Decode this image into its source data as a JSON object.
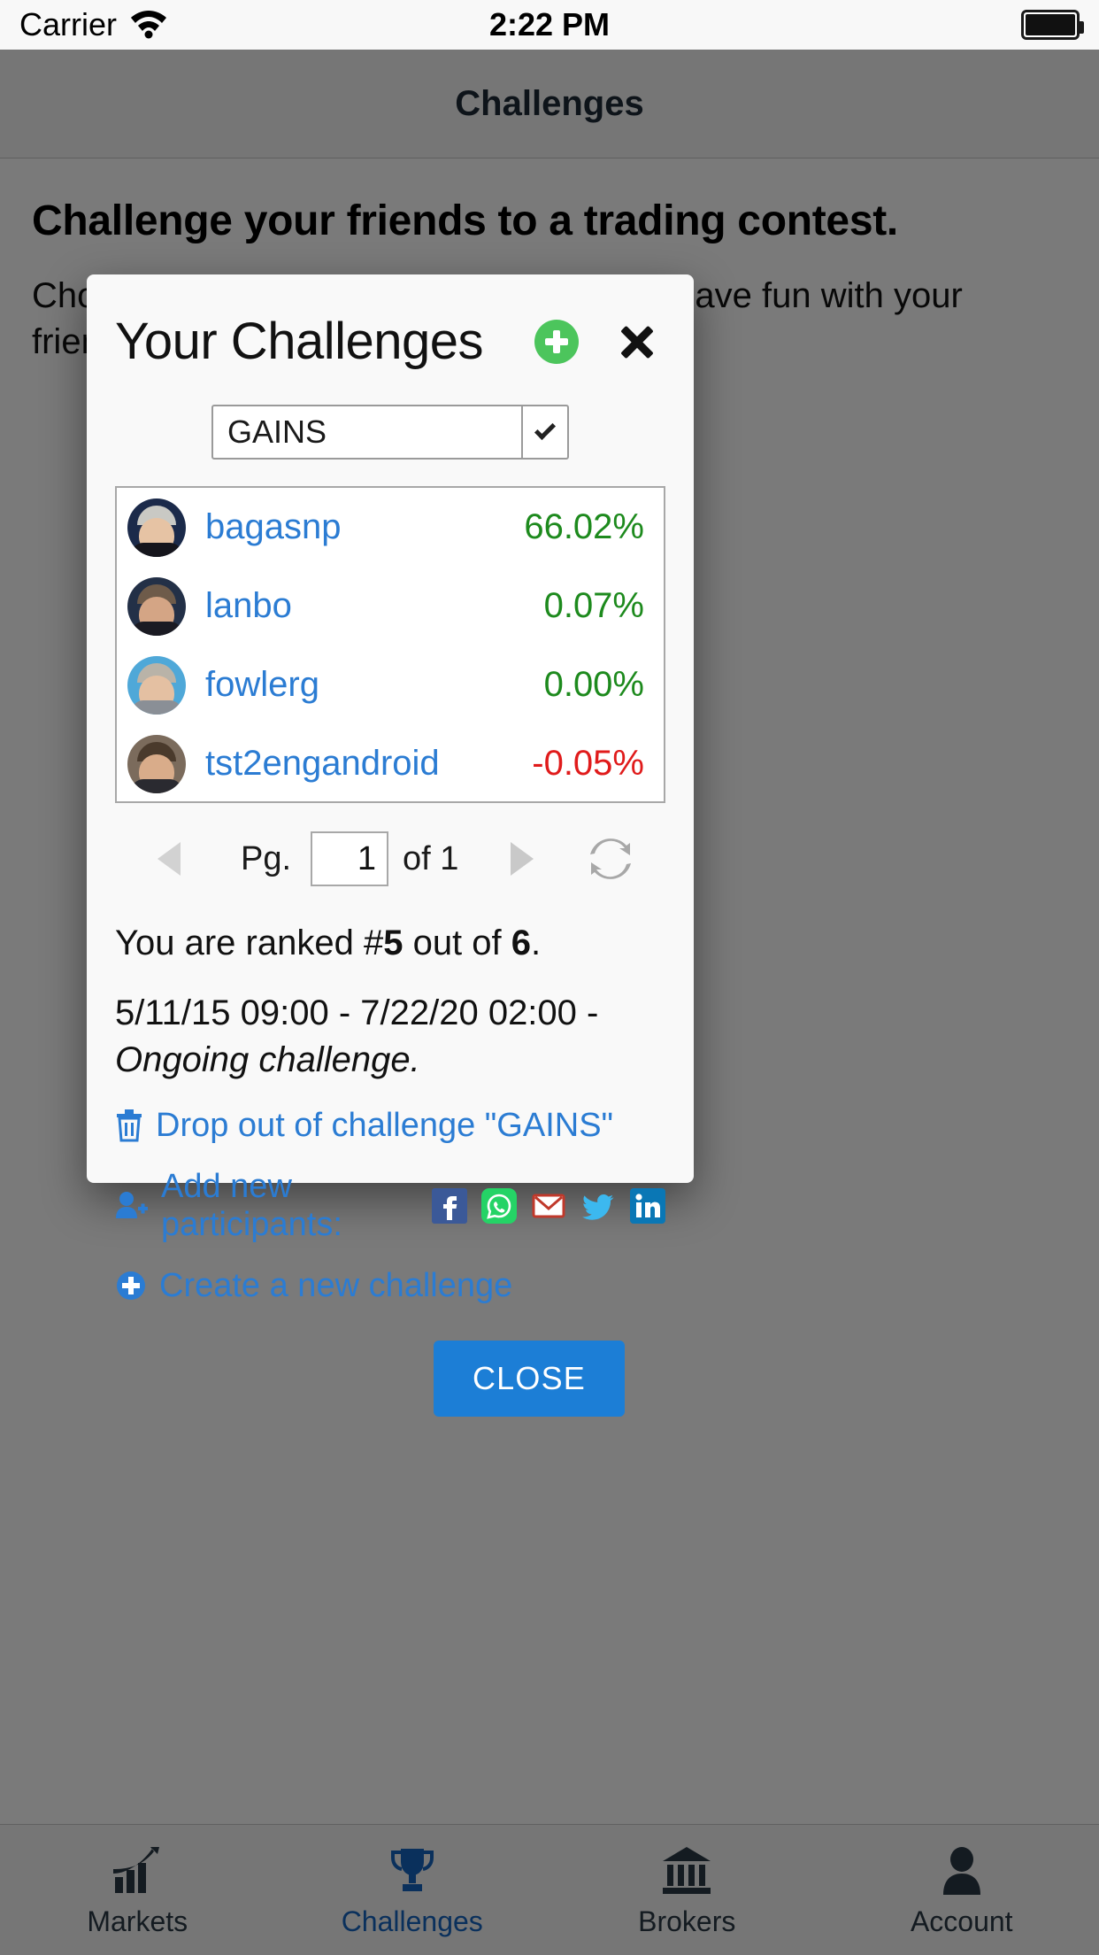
{
  "status_bar": {
    "carrier": "Carrier",
    "wifi_icon": "wifi-icon",
    "time": "2:22 PM",
    "battery_icon": "battery-full-icon"
  },
  "navbar": {
    "title": "Challenges"
  },
  "page": {
    "heading": "Challenge your friends to a trading contest.",
    "subheading": "Choose the dates of the tournament and have fun with your friends."
  },
  "modal": {
    "title": "Your Challenges",
    "add_icon": "plus-circle-icon",
    "close_icon": "close-icon",
    "select": {
      "value": "GAINS",
      "arrow_icon": "chevron-down-icon"
    },
    "leaderboard": [
      {
        "avatar": "avatar",
        "username": "bagasnp",
        "percent": "66.02%",
        "sign": "pos"
      },
      {
        "avatar": "avatar",
        "username": "lanbo",
        "percent": "0.07%",
        "sign": "pos"
      },
      {
        "avatar": "avatar",
        "username": "fowlerg",
        "percent": "0.00%",
        "sign": "pos"
      },
      {
        "avatar": "avatar",
        "username": "tst2engandroid",
        "percent": "-0.05%",
        "sign": "neg"
      }
    ],
    "pager": {
      "prev_icon": "triangle-left-icon",
      "label": "Pg.",
      "page_value": "1",
      "of_text": "of 1",
      "next_icon": "triangle-right-icon",
      "refresh_icon": "refresh-icon"
    },
    "rank": {
      "prefix": "You are ranked #",
      "rank_number": "5",
      "middle": " out of ",
      "total": "6",
      "suffix": "."
    },
    "dates": {
      "range": "5/11/15 09:00 - 7/22/20 02:00 - ",
      "status": "Ongoing challenge."
    },
    "drop_out": {
      "icon": "trash-icon",
      "label": "Drop out of challenge \"GAINS\""
    },
    "add_participants": {
      "icon": "user-plus-icon",
      "label": "Add new participants:",
      "socials": [
        {
          "name": "facebook-icon"
        },
        {
          "name": "whatsapp-icon"
        },
        {
          "name": "email-icon"
        },
        {
          "name": "twitter-icon"
        },
        {
          "name": "linkedin-icon"
        }
      ]
    },
    "create_challenge": {
      "icon": "plus-circle-icon",
      "label": "Create a new challenge"
    },
    "close_button": "CLOSE"
  },
  "tabbar": [
    {
      "icon": "chart-growth-icon",
      "label": "Markets",
      "active": false
    },
    {
      "icon": "trophy-icon",
      "label": "Challenges",
      "active": true
    },
    {
      "icon": "bank-icon",
      "label": "Brokers",
      "active": false
    },
    {
      "icon": "person-icon",
      "label": "Account",
      "active": false
    }
  ],
  "colors": {
    "link_blue": "#2b7cd3",
    "positive_green": "#1d8a1d",
    "negative_red": "#e01b1b",
    "accent_blue": "#1c7ed6",
    "add_green": "#4cc55c",
    "tab_active": "#1565c0"
  }
}
